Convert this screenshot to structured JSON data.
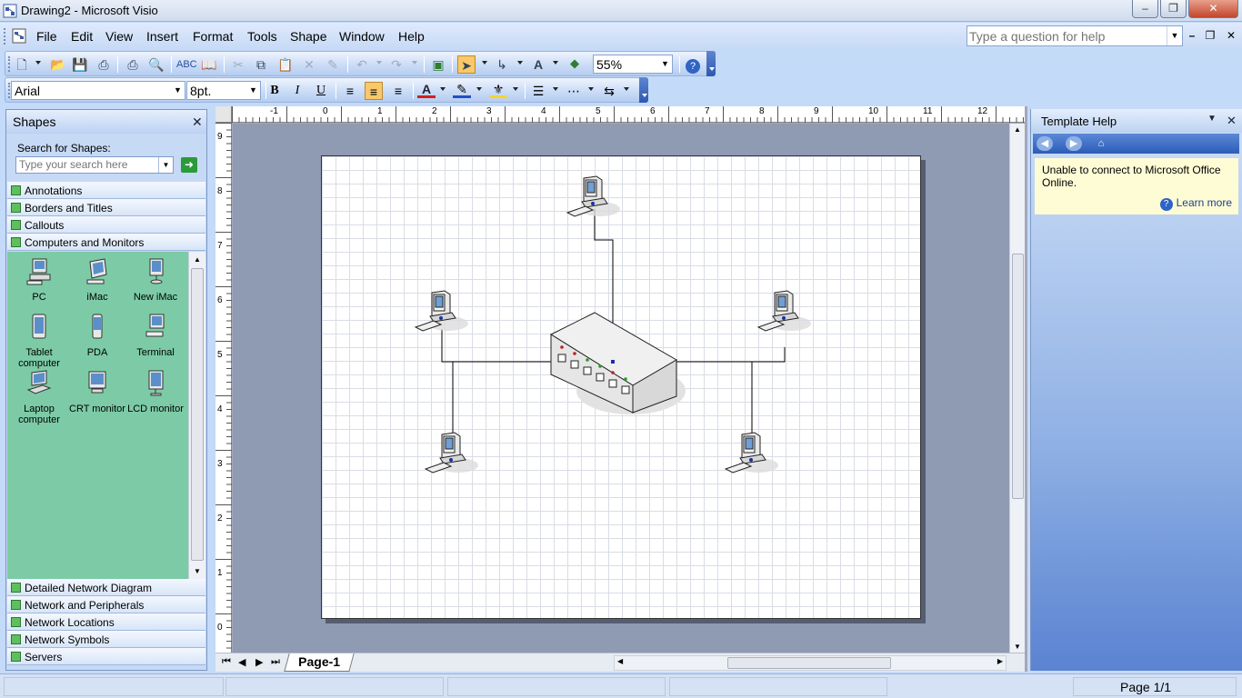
{
  "window": {
    "title": "Drawing2 - Microsoft Visio"
  },
  "menu": {
    "items": [
      "File",
      "Edit",
      "View",
      "Insert",
      "Format",
      "Tools",
      "Shape",
      "Window",
      "Help"
    ],
    "help_placeholder": "Type a question for help"
  },
  "toolbar": {
    "zoom": "55%",
    "font": "Arial",
    "font_size": "8pt."
  },
  "shapes_pane": {
    "title": "Shapes",
    "search_label": "Search for Shapes:",
    "search_placeholder": "Type your search here",
    "stencils_top": [
      "Annotations",
      "Borders and Titles",
      "Callouts",
      "Computers and Monitors"
    ],
    "shapes": [
      {
        "label": "PC",
        "icon": "pc-icon"
      },
      {
        "label": "iMac",
        "icon": "imac-icon"
      },
      {
        "label": "New iMac",
        "icon": "new-imac-icon"
      },
      {
        "label": "Tablet computer",
        "icon": "tablet-icon"
      },
      {
        "label": "PDA",
        "icon": "pda-icon"
      },
      {
        "label": "Terminal",
        "icon": "terminal-icon"
      },
      {
        "label": "Laptop computer",
        "icon": "laptop-icon"
      },
      {
        "label": "CRT monitor",
        "icon": "crt-monitor-icon"
      },
      {
        "label": "LCD monitor",
        "icon": "lcd-monitor-icon"
      }
    ],
    "stencils_bottom": [
      "Detailed Network Diagram",
      "Network and Peripherals",
      "Network Locations",
      "Network Symbols",
      "Servers"
    ]
  },
  "ruler": {
    "top_labels": [
      "-1",
      "0",
      "1",
      "2",
      "3",
      "4",
      "5",
      "6",
      "7",
      "8",
      "9",
      "10",
      "11",
      "12"
    ],
    "left_labels": [
      "9",
      "8",
      "7",
      "6",
      "5",
      "4",
      "3",
      "2",
      "1",
      "0"
    ]
  },
  "diagram": {
    "nodes": [
      "pc-top",
      "pc-left",
      "pc-right",
      "pc-bottom-left",
      "pc-bottom-right",
      "network-switch"
    ]
  },
  "page_tabs": {
    "current": "Page-1"
  },
  "template_help": {
    "title": "Template Help",
    "message": "Unable to connect to Microsoft Office Online.",
    "link": "Learn more"
  },
  "status": {
    "page": "Page 1/1"
  },
  "colors": {
    "stencil_bg": "#7ccba6",
    "canvas_bg": "#8f9ab3",
    "accent": "#2e58b0"
  }
}
